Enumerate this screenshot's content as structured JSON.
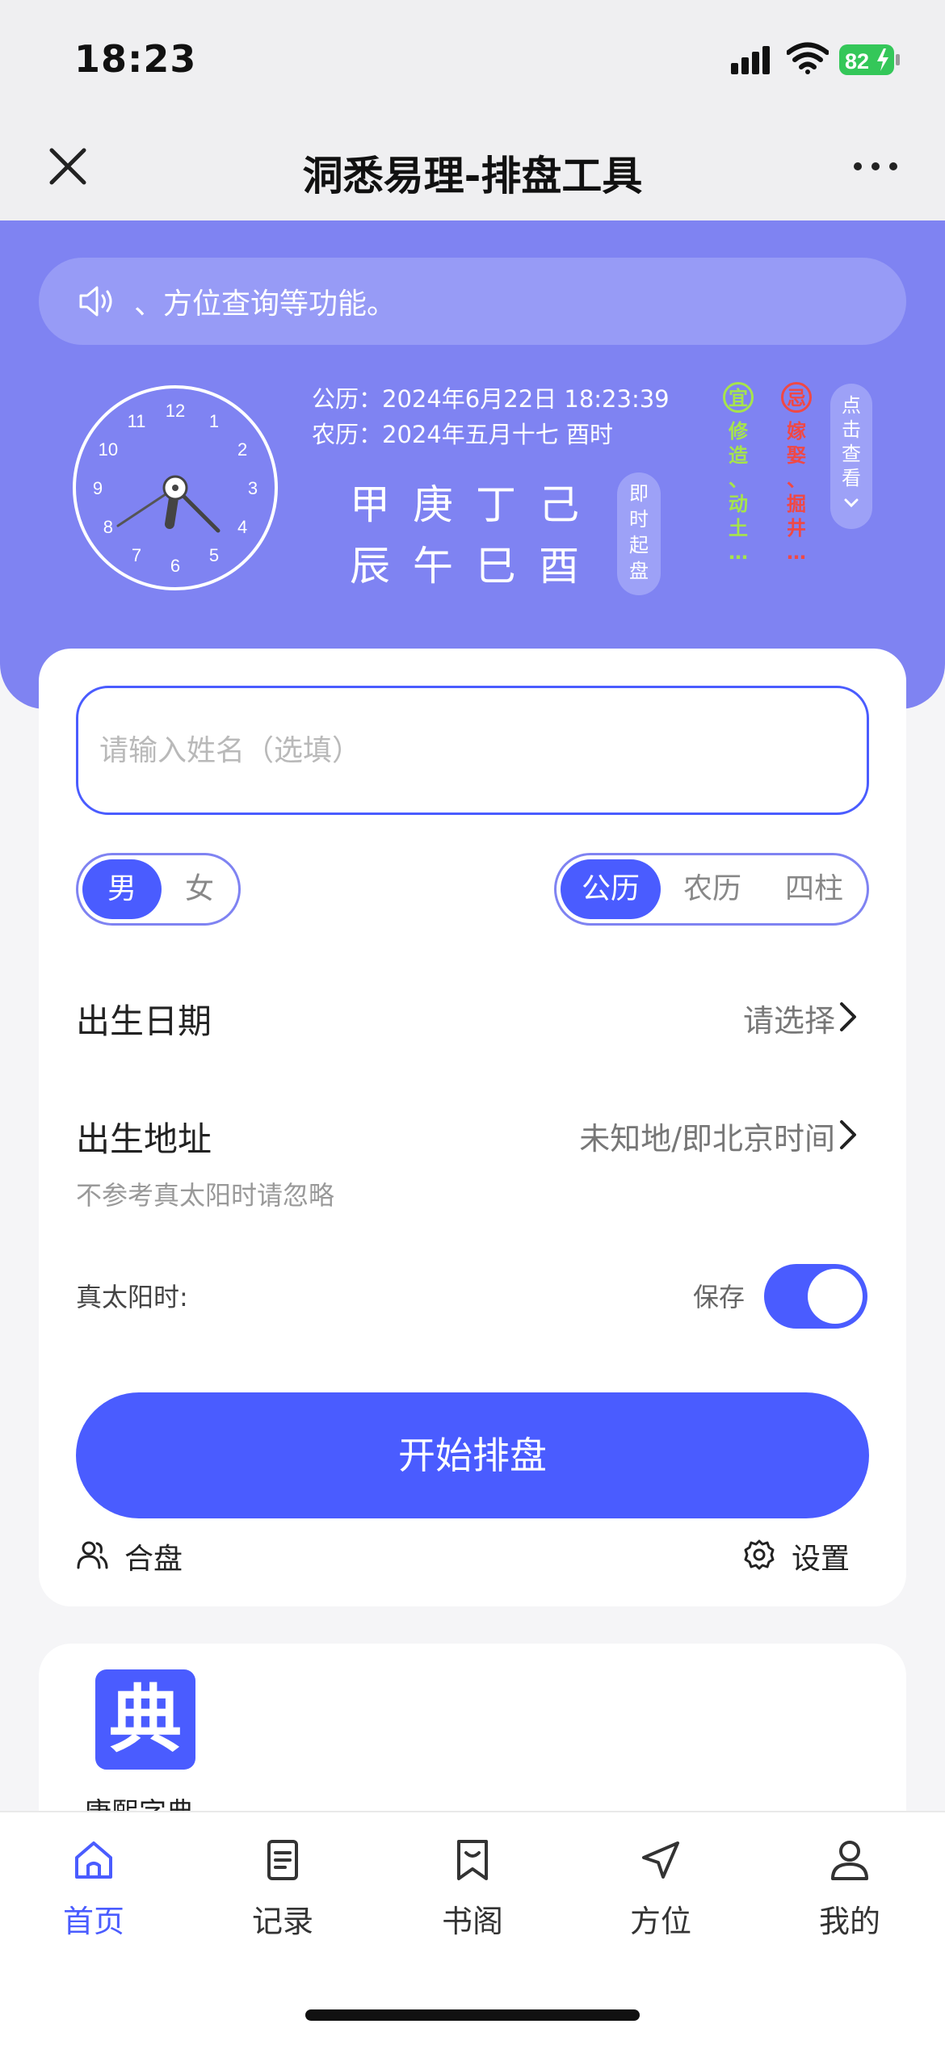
{
  "status_bar": {
    "time": "18:23",
    "battery_level": "82",
    "battery_color": "#34c759"
  },
  "nav": {
    "title": "洞悉易理-排盘工具",
    "close_icon": "close-icon",
    "more_icon": "more-icon"
  },
  "header": {
    "notice_text": "、方位查询等功能。",
    "solar_date": "公历：2024年6月22日 18:23:39",
    "lunar_date": "农历：2024年五月十七 酉时",
    "ganzhi_top": [
      "甲",
      "庚",
      "丁",
      "己"
    ],
    "ganzhi_bottom": [
      "辰",
      "午",
      "巳",
      "酉"
    ],
    "instant_label": [
      "即",
      "时",
      "起",
      "盘"
    ],
    "yi": {
      "badge": "宜",
      "text": [
        "修",
        "造",
        "、",
        "动",
        "土",
        "…"
      ]
    },
    "ji": {
      "badge": "忌",
      "text": [
        "嫁",
        "娶",
        "、",
        "掘",
        "井",
        "…"
      ]
    },
    "check_label": [
      "点",
      "击",
      "查",
      "看"
    ],
    "clock_numbers": [
      "12",
      "1",
      "2",
      "3",
      "4",
      "5",
      "6",
      "7",
      "8",
      "9",
      "10",
      "11"
    ]
  },
  "form": {
    "name_placeholder": "请输入姓名（选填）",
    "gender": {
      "options": [
        "男",
        "女"
      ],
      "selected": "男"
    },
    "calendar": {
      "options": [
        "公历",
        "农历",
        "四柱"
      ],
      "selected": "公历"
    },
    "birth_date_label": "出生日期",
    "birth_date_value": "请选择",
    "birth_place_label": "出生地址",
    "birth_place_value": "未知地/即北京时间",
    "birth_place_hint": "不参考真太阳时请忽略",
    "true_solar_label": "真太阳时:",
    "save_label": "保存",
    "save_toggle_on": true,
    "start_button": "开始排盘",
    "match_link": "合盘",
    "settings_link": "设置"
  },
  "tools": {
    "dict_icon_char": "典",
    "dict_label": "康熙字典"
  },
  "tabs": [
    {
      "label": "首页",
      "icon": "home-icon",
      "active": true
    },
    {
      "label": "记录",
      "icon": "document-icon",
      "active": false
    },
    {
      "label": "书阁",
      "icon": "bookmark-icon",
      "active": false
    },
    {
      "label": "方位",
      "icon": "navigation-icon",
      "active": false
    },
    {
      "label": "我的",
      "icon": "user-icon",
      "active": false
    }
  ],
  "colors": {
    "primary": "#4a5cff",
    "header_bg": "#7f83f2",
    "yi_green": "#a6e44c",
    "ji_red": "#f04845"
  }
}
